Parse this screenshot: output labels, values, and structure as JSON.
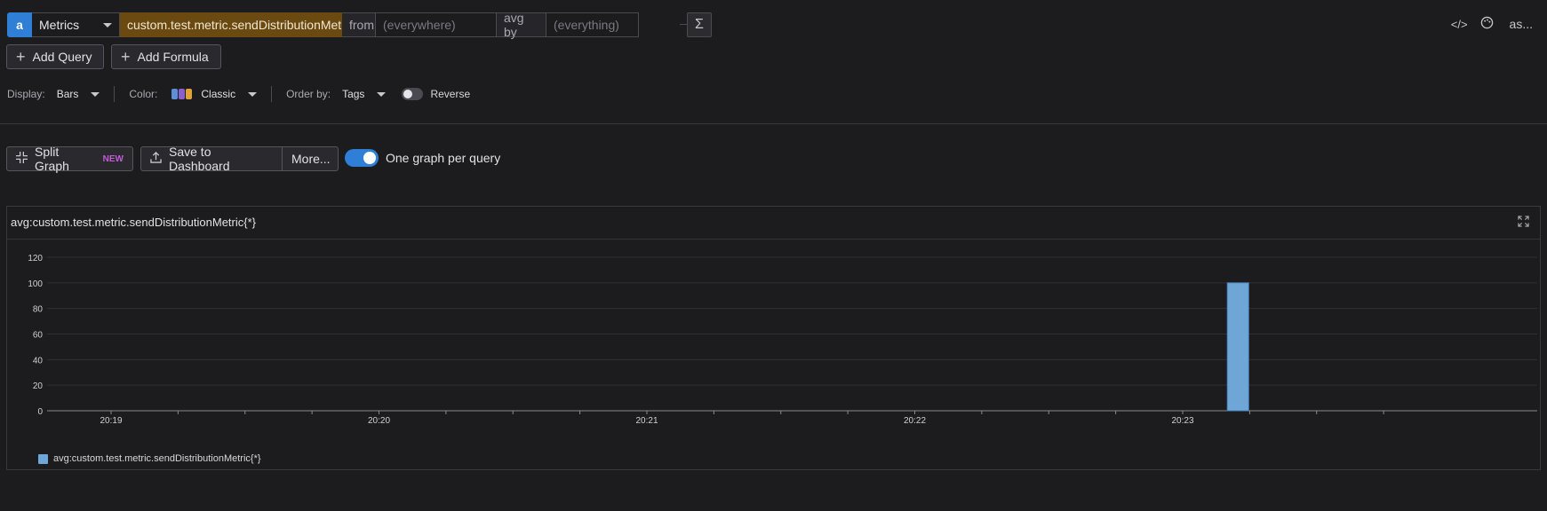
{
  "query": {
    "letter": "a",
    "source": "Metrics",
    "metric": "custom.test.metric.sendDistributionMetric",
    "from_label": "from",
    "from_placeholder": "(everywhere)",
    "agg_label": "avg by",
    "agg_placeholder": "(everything)",
    "sum_symbol": "Σ"
  },
  "top_right": {
    "code_icon": "</>",
    "palette_icon": "palette-icon",
    "more_text": "as..."
  },
  "buttons": {
    "add_query": "Add Query",
    "add_formula": "Add Formula"
  },
  "display_options": {
    "display_label": "Display:",
    "display_value": "Bars",
    "color_label": "Color:",
    "color_value": "Classic",
    "order_label": "Order by:",
    "order_value": "Tags",
    "reverse_label": "Reverse",
    "swatch_colors": [
      "#5e8fd4",
      "#8a5fcf",
      "#e0a33a"
    ]
  },
  "actions": {
    "split_graph": "Split Graph",
    "new_badge": "NEW",
    "save_dashboard": "Save to Dashboard",
    "more": "More...",
    "one_graph": "One graph per query"
  },
  "graph": {
    "title": "avg:custom.test.metric.sendDistributionMetric{*}"
  },
  "chart_data": {
    "type": "bar",
    "title": "avg:custom.test.metric.sendDistributionMetric{*}",
    "xlabel": "",
    "ylabel": "",
    "x_ticks": [
      "20:19",
      "20:20",
      "20:21",
      "20:22",
      "20:23"
    ],
    "y_ticks": [
      0,
      20,
      40,
      60,
      80,
      100,
      120
    ],
    "ylim": [
      0,
      120
    ],
    "grid": true,
    "legend_position": "bottom-left",
    "series": [
      {
        "name": "avg:custom.test.metric.sendDistributionMetric{*}",
        "color": "#6ea6d8",
        "points": [
          {
            "x": "20:23:10",
            "y": 100
          }
        ]
      }
    ]
  }
}
